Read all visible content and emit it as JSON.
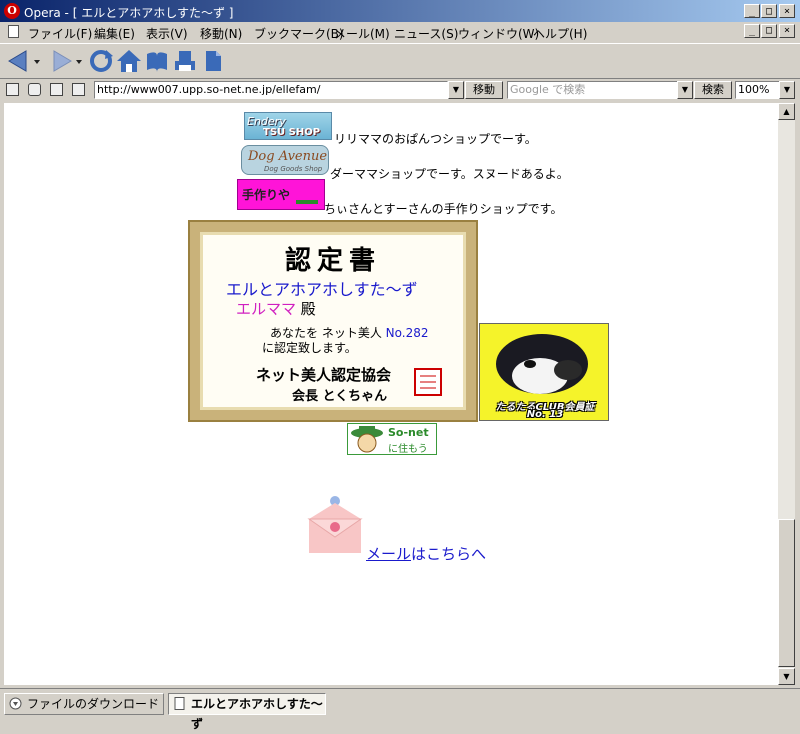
{
  "window": {
    "title": "Opera - [ エルとアホアホしすた～ず ]",
    "app_icon": "O",
    "controls": [
      "_",
      "□",
      "×"
    ]
  },
  "menubar": {
    "items": [
      "ファイル(F)",
      "編集(E)",
      "表示(V)",
      "移動(N)",
      "ブックマーク(B)",
      "メール(M)",
      "ニュース(S)",
      "ウィンドウ(W)",
      "ヘルプ(H)"
    ]
  },
  "toolbar": {
    "icons": [
      "back-icon",
      "forward-icon",
      "reload-icon",
      "home-icon",
      "bookmarks-icon",
      "print-icon",
      "notes-icon"
    ]
  },
  "addressbar": {
    "url": "http://www007.upp.so-net.ne.jp/ellefam/",
    "go_label": "移動",
    "search_placeholder": "Google で検索",
    "search_label": "検索",
    "zoom": "100%"
  },
  "page": {
    "shops": [
      {
        "banner_text": "Wanchan-EnMERY ATSU SHOP",
        "banner_line1": "Endery",
        "banner_line2": "TSU SHOP",
        "desc": "リリママのおぱんつショップでーす。"
      },
      {
        "banner_text": "Dog Avenue Dog Goods Shop",
        "banner_line1": "Dog Avenue",
        "banner_line2": "Dog Goods Shop",
        "desc": "ダーママショップでーす。スヌードあるよ。"
      },
      {
        "banner_text": "手作りや",
        "banner_line1": "手作りや",
        "banner_line2": "",
        "desc": "ちぃさんとすーさんの手作りショップです。"
      }
    ],
    "certificate": {
      "title": "認定書",
      "team": "エルとアホアホしすた～ず",
      "name": "エルママ",
      "honorific": "殿",
      "text_prefix": "あなたを ネット美人 ",
      "number": "No.282",
      "text_suffix": "に認定致します。",
      "org": "ネット美人認定協会",
      "president": "会長 とくちゃん",
      "seal_text": "ネット美人認定協会会長之印"
    },
    "club_badge": {
      "caption1": "たるたるCLUB会員証",
      "caption2": "No. 13"
    },
    "sonet_badge": {
      "line1": "So-net",
      "line2": "に住もう"
    },
    "mail": {
      "link_text": "メール",
      "suffix": "はこちらへ"
    }
  },
  "statusbar": {
    "tabs": [
      {
        "label": "ファイルのダウンロード",
        "active": false
      },
      {
        "label": "エルとアホアホしすた～ず",
        "active": true
      }
    ]
  },
  "colors": {
    "titlebar_start": "#0a246a",
    "titlebar_end": "#a6caf0",
    "link": "#1a1acc",
    "cert_frame": "#c9b27a",
    "club_bg": "#f5f32a"
  }
}
